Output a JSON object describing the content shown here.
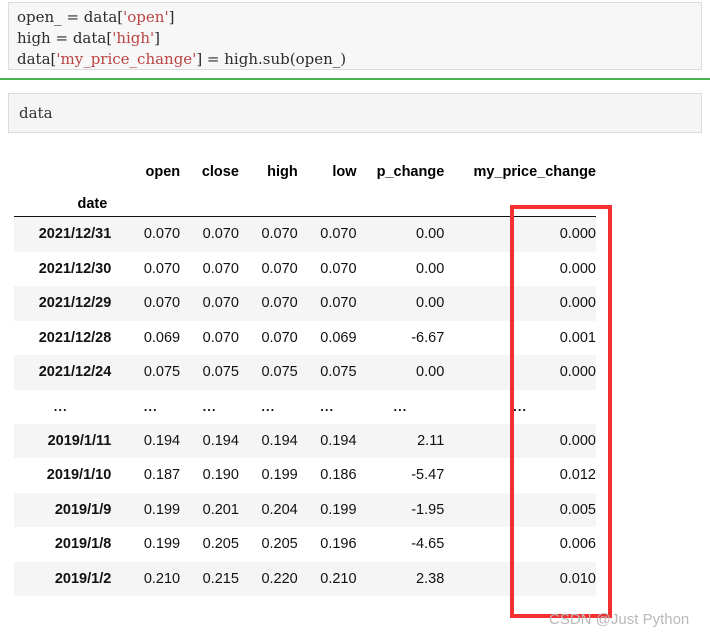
{
  "code_cell": {
    "lines": [
      [
        {
          "t": "plain",
          "s": "open_ = data["
        },
        {
          "t": "str",
          "s": "'open'"
        },
        {
          "t": "plain",
          "s": "]"
        }
      ],
      [
        {
          "t": "plain",
          "s": "high = data["
        },
        {
          "t": "str",
          "s": "'high'"
        },
        {
          "t": "plain",
          "s": "]"
        }
      ],
      [
        {
          "t": "plain",
          "s": "data["
        },
        {
          "t": "str",
          "s": "'my_price_change'"
        },
        {
          "t": "plain",
          "s": "] = high.sub(open_)"
        }
      ]
    ]
  },
  "output_cell": {
    "text": "data"
  },
  "table": {
    "index_name": "date",
    "columns": [
      "open",
      "close",
      "high",
      "low",
      "p_change",
      "my_price_change"
    ],
    "rows": [
      {
        "date": "2021/12/31",
        "values": [
          "0.070",
          "0.070",
          "0.070",
          "0.070",
          "0.00",
          "0.000"
        ]
      },
      {
        "date": "2021/12/30",
        "values": [
          "0.070",
          "0.070",
          "0.070",
          "0.070",
          "0.00",
          "0.000"
        ]
      },
      {
        "date": "2021/12/29",
        "values": [
          "0.070",
          "0.070",
          "0.070",
          "0.070",
          "0.00",
          "0.000"
        ]
      },
      {
        "date": "2021/12/28",
        "values": [
          "0.069",
          "0.070",
          "0.070",
          "0.069",
          "-6.67",
          "0.001"
        ]
      },
      {
        "date": "2021/12/24",
        "values": [
          "0.075",
          "0.075",
          "0.075",
          "0.075",
          "0.00",
          "0.000"
        ]
      },
      {
        "date": "...",
        "values": [
          "...",
          "...",
          "...",
          "...",
          "...",
          "..."
        ]
      },
      {
        "date": "2019/1/11",
        "values": [
          "0.194",
          "0.194",
          "0.194",
          "0.194",
          "2.11",
          "0.000"
        ]
      },
      {
        "date": "2019/1/10",
        "values": [
          "0.187",
          "0.190",
          "0.199",
          "0.186",
          "-5.47",
          "0.012"
        ]
      },
      {
        "date": "2019/1/9",
        "values": [
          "0.199",
          "0.201",
          "0.204",
          "0.199",
          "-1.95",
          "0.005"
        ]
      },
      {
        "date": "2019/1/8",
        "values": [
          "0.199",
          "0.205",
          "0.205",
          "0.196",
          "-4.65",
          "0.006"
        ]
      },
      {
        "date": "2019/1/2",
        "values": [
          "0.210",
          "0.215",
          "0.220",
          "0.210",
          "2.38",
          "0.010"
        ]
      }
    ]
  },
  "annotation": {
    "highlight_color": "#f43030",
    "highlighted_column": "my_price_change"
  },
  "watermark": {
    "text": "CSDN @Just Python"
  }
}
